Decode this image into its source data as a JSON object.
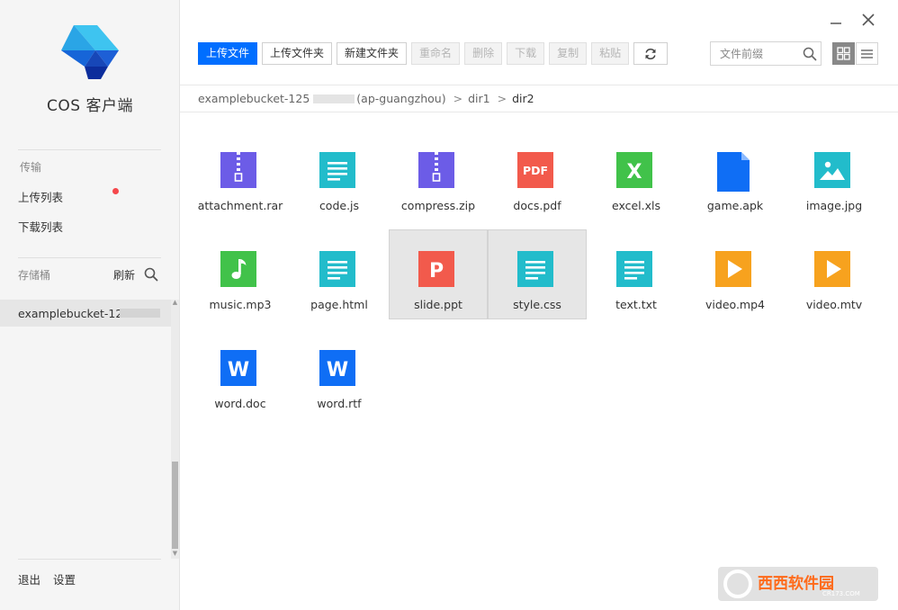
{
  "app": {
    "title": "COS 客户端"
  },
  "sidebar": {
    "transfer_label": "传输",
    "upload_list": "上传列表",
    "download_list": "下载列表",
    "bucket_label": "存储桶",
    "refresh": "刷新",
    "bucket_item": "examplebucket-125",
    "logout": "退出",
    "settings": "设置",
    "upload_badge_color": "#f5484c"
  },
  "toolbar": {
    "upload_file": "上传文件",
    "upload_folder": "上传文件夹",
    "new_folder": "新建文件夹",
    "rename": "重命名",
    "delete": "删除",
    "download": "下载",
    "copy": "复制",
    "paste": "粘贴",
    "accent_color": "#006eff"
  },
  "search": {
    "placeholder": "文件前缀"
  },
  "breadcrumb": {
    "bucket": "examplebucket-125",
    "region": "(ap-guangzhou)",
    "sep1": ">",
    "dir1": "dir1",
    "sep2": ">",
    "dir2": "dir2"
  },
  "files": [
    {
      "name": "attachment.rar",
      "icon": "archive-icon"
    },
    {
      "name": "code.js",
      "icon": "text-doc-icon"
    },
    {
      "name": "compress.zip",
      "icon": "archive-icon"
    },
    {
      "name": "docs.pdf",
      "icon": "pdf-icon",
      "glyph": "PDF"
    },
    {
      "name": "excel.xls",
      "icon": "excel-icon",
      "glyph": "X"
    },
    {
      "name": "game.apk",
      "icon": "apk-file-icon"
    },
    {
      "name": "image.jpg",
      "icon": "image-icon"
    },
    {
      "name": "music.mp3",
      "icon": "music-icon"
    },
    {
      "name": "page.html",
      "icon": "text-doc-icon"
    },
    {
      "name": "slide.ppt",
      "icon": "ppt-icon",
      "glyph": "P",
      "selected": true
    },
    {
      "name": "style.css",
      "icon": "text-doc-icon",
      "selected": true
    },
    {
      "name": "text.txt",
      "icon": "text-doc-icon"
    },
    {
      "name": "video.mp4",
      "icon": "video-icon"
    },
    {
      "name": "video.mtv",
      "icon": "video-icon"
    },
    {
      "name": "word.doc",
      "icon": "word-icon",
      "glyph": "W"
    },
    {
      "name": "word.rtf",
      "icon": "word-icon",
      "glyph": "W"
    }
  ],
  "icon_colors": {
    "archive": "#6c5ce7",
    "text": "#22bccb",
    "pdf": "#f25a4c",
    "excel": "#41c24a",
    "apk": "#0f6ef5",
    "image": "#22bccb",
    "music": "#41c24a",
    "ppt": "#f25a4c",
    "video": "#f7a21e",
    "word": "#0f6ef5"
  },
  "watermark": {
    "text": "西西软件园",
    "url_text": "CR173.COM"
  }
}
